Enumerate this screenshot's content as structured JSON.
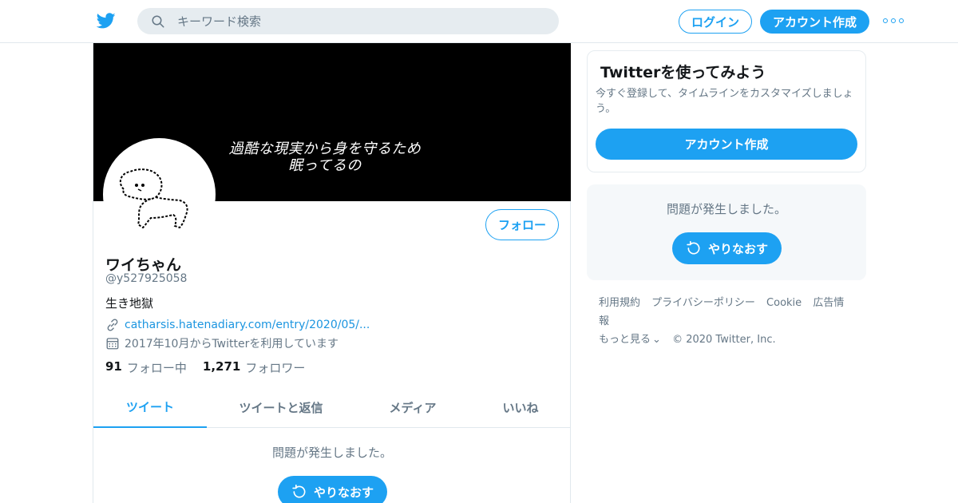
{
  "nav": {
    "search_placeholder": "キーワード検索",
    "login_label": "ログイン",
    "signup_label": "アカウント作成",
    "brand_color": "#1da1f2"
  },
  "profile": {
    "header_text_line1": "過酷な現実から身を守るため",
    "header_text_line2": "眠ってるの",
    "follow_label": "フォロー",
    "display_name": "ワイちゃん",
    "handle": "@y527925058",
    "bio": "生き地獄",
    "link": "catharsis.hatenadiary.com/entry/2020/05/...",
    "joined": "2017年10月からTwitterを利用しています",
    "following_count": "91",
    "following_label": "フォロー中",
    "followers_count": "1,271",
    "followers_label": "フォロワー"
  },
  "tabs": [
    {
      "label": "ツイート",
      "active": true
    },
    {
      "label": "ツイートと返信",
      "active": false
    },
    {
      "label": "メディア",
      "active": false
    },
    {
      "label": "いいね",
      "active": false
    }
  ],
  "timeline": {
    "error_message": "問題が発生しました。",
    "retry_label": "やりなおす"
  },
  "sidebar": {
    "signup_card": {
      "title": "Twitterを使ってみよう",
      "subtitle": "今すぐ登録して、タイムラインをカスタマイズしましょう。",
      "button_label": "アカウント作成"
    },
    "error_card": {
      "message": "問題が発生しました。",
      "retry_label": "やりなおす"
    },
    "footer": {
      "terms": "利用規約",
      "privacy": "プライバシーポリシー",
      "cookie": "Cookie",
      "ads": "広告情報",
      "more": "もっと見る",
      "copyright": "© 2020 Twitter, Inc."
    }
  }
}
